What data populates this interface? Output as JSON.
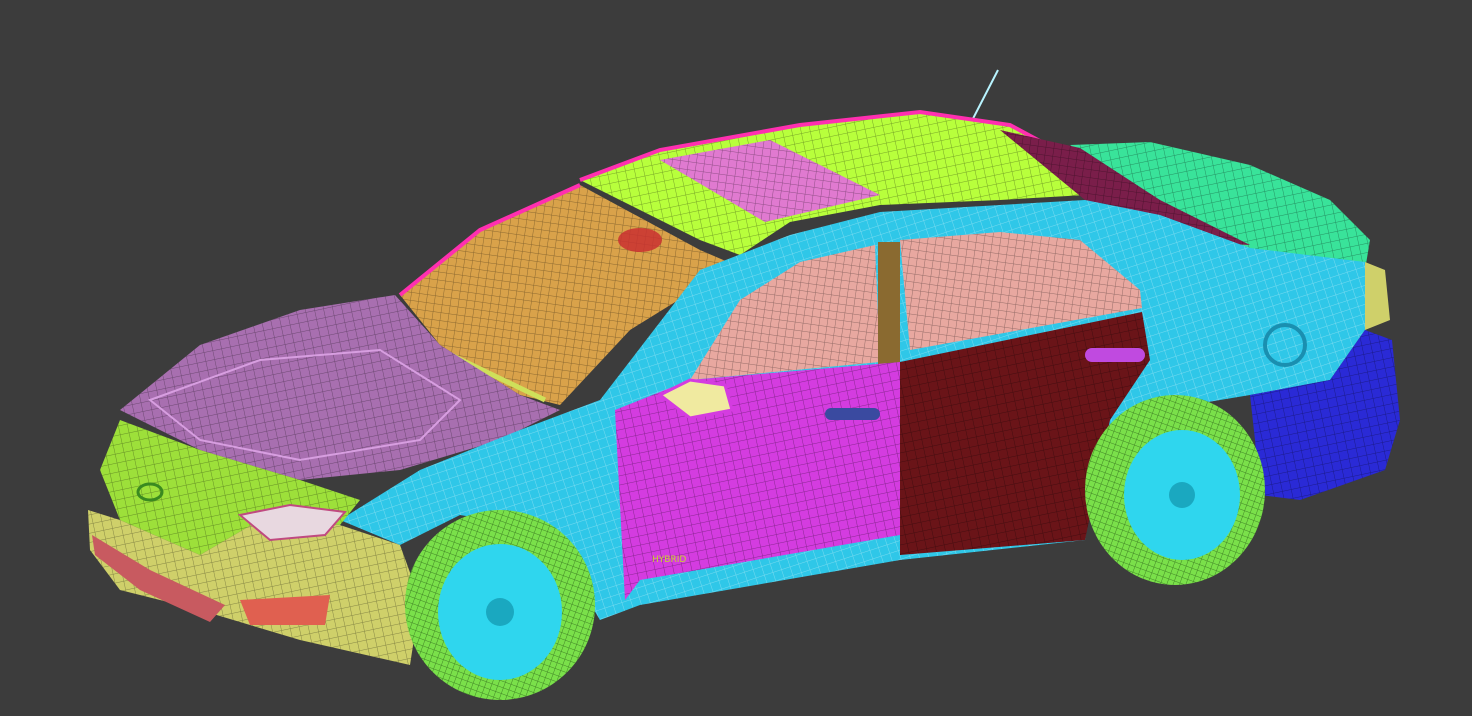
{
  "scene": {
    "background_color": "#3c3c3c",
    "subject": "car-wireframe-mesh",
    "badge_text": "HYBRID",
    "colors": {
      "roof": "#b8ff3c",
      "sunroof": "#e07ad0",
      "windshield": "#d9a24a",
      "hood": "#a86fb0",
      "grille": "#9de03a",
      "bumper": "#cfd06a",
      "body_cyan": "#2fc7e8",
      "front_door": "#d43ce0",
      "rear_door": "#6a1418",
      "interior": "#e8a8a0",
      "trunk": "#39e39a",
      "rear_bumper": "#2a2ad6",
      "tire": "#7ae04a",
      "rim": "#2fd6ee",
      "headlight": "#e06050",
      "antenna": "#b8f4ff",
      "outline_pink": "#ff2fb0"
    }
  }
}
